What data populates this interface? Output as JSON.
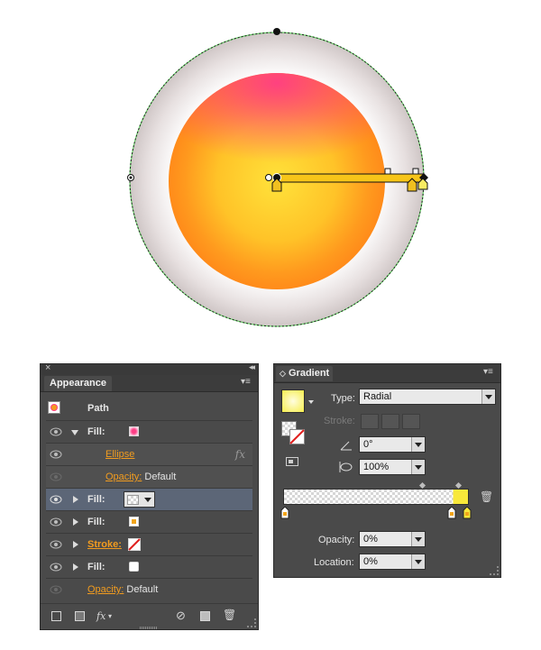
{
  "appearance": {
    "tab_label": "Appearance",
    "rows": [
      {
        "label": "Path"
      },
      {
        "label": "Fill:"
      },
      {
        "label": "Ellipse"
      },
      {
        "label": "Opacity:",
        "value": "Default"
      },
      {
        "label": "Fill:"
      },
      {
        "label": "Fill:"
      },
      {
        "label": "Stroke:"
      },
      {
        "label": "Fill:"
      },
      {
        "label": "Opacity:",
        "value": "Default"
      }
    ],
    "fx_label": "fx",
    "bottom_fx_label": "fx"
  },
  "gradient": {
    "tab_label": "Gradient",
    "type_label": "Type:",
    "type_value": "Radial",
    "stroke_label": "Stroke:",
    "angle_value": "0°",
    "aspect_value": "100%",
    "opacity_label": "Opacity:",
    "opacity_value": "0%",
    "location_label": "Location:",
    "location_value": "0%"
  },
  "colors": {
    "accent_link": "#f29c1f",
    "selection": "#5c6677",
    "panel_bg": "#4a4a4a",
    "gradient_yellow": "#f8e83a"
  }
}
